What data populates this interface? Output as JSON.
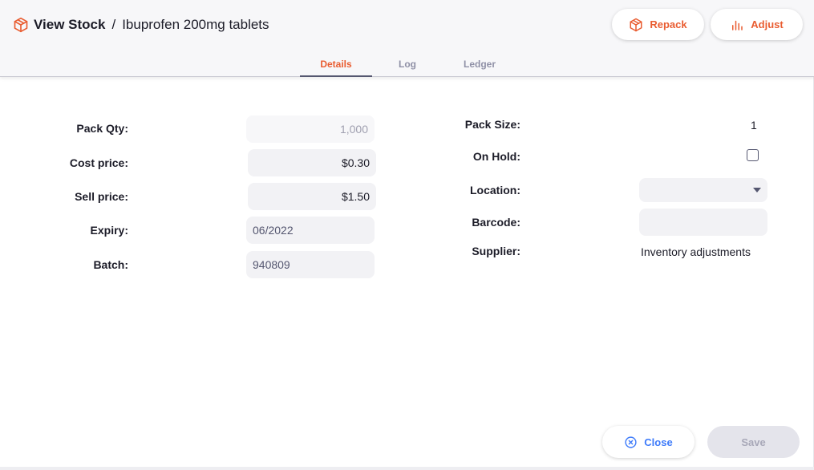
{
  "header": {
    "title": "View Stock",
    "separator": "/",
    "subtitle": "Ibuprofen 200mg tablets",
    "title_icon": "box-icon"
  },
  "actions": {
    "repack_label": "Repack",
    "repack_icon": "box-icon",
    "adjust_label": "Adjust",
    "adjust_icon": "bar-chart-icon"
  },
  "tabs": [
    {
      "label": "Details",
      "active": true
    },
    {
      "label": "Log",
      "active": false
    },
    {
      "label": "Ledger",
      "active": false
    }
  ],
  "left_form": {
    "pack_qty_label": "Pack Qty:",
    "pack_qty_value": "1,000",
    "cost_price_label": "Cost price:",
    "cost_price_value": "$0.30",
    "sell_price_label": "Sell price:",
    "sell_price_value": "$1.50",
    "expiry_label": "Expiry:",
    "expiry_value": "06/2022",
    "batch_label": "Batch:",
    "batch_value": "940809"
  },
  "right_form": {
    "pack_size_label": "Pack Size:",
    "pack_size_value": "1",
    "on_hold_label": "On Hold:",
    "on_hold_checked": false,
    "location_label": "Location:",
    "location_value": "",
    "barcode_label": "Barcode:",
    "barcode_value": "",
    "supplier_label": "Supplier:",
    "supplier_value": "Inventory adjustments"
  },
  "footer": {
    "close_label": "Close",
    "close_icon": "close-circle-icon",
    "save_label": "Save"
  },
  "colors": {
    "accent": "#e95c30",
    "link_blue": "#3e7bfa",
    "field_bg": "#f2f2f5"
  }
}
